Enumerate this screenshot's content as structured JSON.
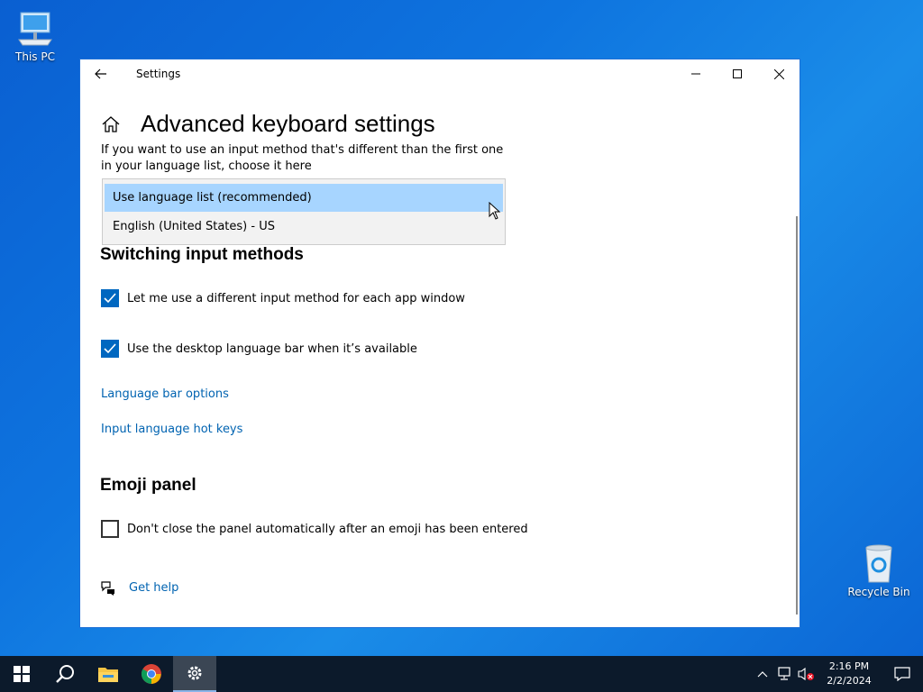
{
  "desktop": {
    "this_pc_label": "This PC",
    "recycle_bin_label": "Recycle Bin"
  },
  "window": {
    "title": "Settings",
    "page_title": "Advanced keyboard settings",
    "description": "If you want to use an input method that's different than the first one in your language list, choose it here",
    "dropdown": {
      "options": [
        "Use language list (recommended)",
        "English (United States) - US"
      ],
      "highlighted_index": 0
    },
    "switching": {
      "title": "Switching input methods",
      "check1": {
        "label": "Let me use a different input method for each app window",
        "checked": true
      },
      "check2": {
        "label": "Use the desktop language bar when it’s available",
        "checked": true
      },
      "link1": "Language bar options",
      "link2": "Input language hot keys"
    },
    "emoji": {
      "title": "Emoji panel",
      "check": {
        "label": "Don't close the panel automatically after an emoji has been entered",
        "checked": false
      }
    },
    "help_link": "Get help"
  },
  "taskbar": {
    "time": "2:16 PM",
    "date": "2/2/2024"
  },
  "colors": {
    "accent": "#0067c0",
    "link": "#0063b1",
    "highlight": "#a7d5ff",
    "taskbar": "#0c1a2b"
  }
}
